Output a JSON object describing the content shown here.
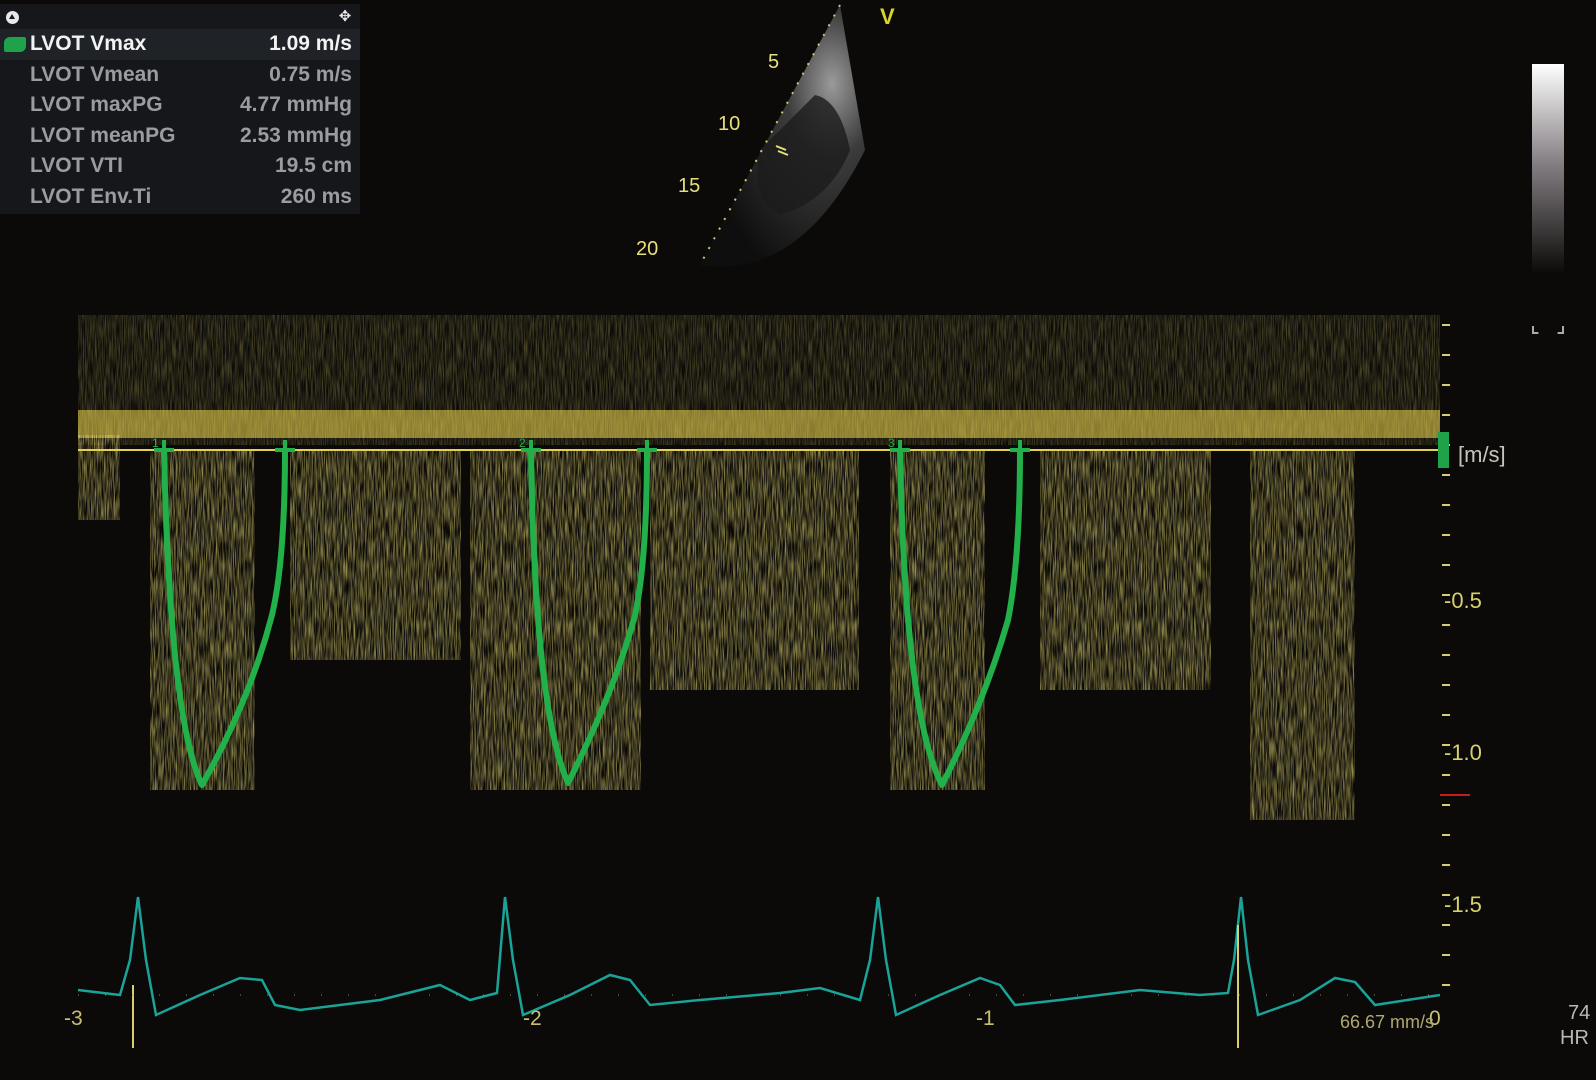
{
  "measurements": {
    "rows": [
      {
        "label": "LVOT Vmax",
        "value": "1.09 m/s",
        "active": true
      },
      {
        "label": "LVOT Vmean",
        "value": "0.75 m/s"
      },
      {
        "label": "LVOT maxPG",
        "value": "4.77 mmHg"
      },
      {
        "label": "LVOT meanPG",
        "value": "2.53 mmHg"
      },
      {
        "label": "LVOT VTI",
        "value": "19.5 cm"
      },
      {
        "label": "LVOT Env.Ti",
        "value": "260 ms"
      }
    ]
  },
  "sector": {
    "view_label": "V",
    "depth_marks": [
      "5",
      "10",
      "15",
      "20"
    ]
  },
  "doppler": {
    "unit": "[m/s]",
    "velocity_ticks": [
      "-0.5",
      "-1.0",
      "-1.5"
    ],
    "time_ticks": [
      "-3",
      "-2",
      "-1",
      "0"
    ],
    "sweep_speed": "66.67 mm/s",
    "trace_markers": [
      "1",
      "2",
      "3"
    ]
  },
  "heart_rate": {
    "value": "74",
    "label": "HR"
  },
  "colors": {
    "doppler": "#e6c832",
    "trace": "#1ea34a",
    "ecg": "#1aa398",
    "tick": "#d8d070"
  }
}
